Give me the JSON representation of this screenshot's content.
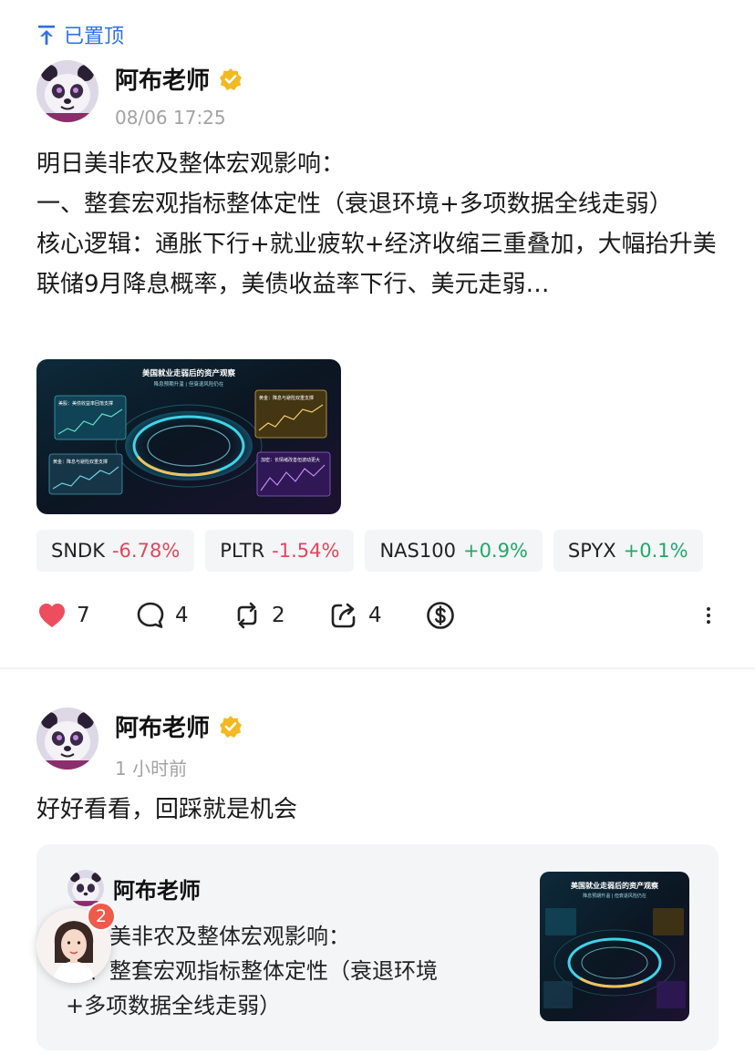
{
  "pinned": {
    "label": "已置顶",
    "icon": "pin-top-icon",
    "color": "#2f6fe8"
  },
  "post1": {
    "author": "阿布老师",
    "verified_icon": "verified-badge-icon",
    "time": "08/06 17:25",
    "lines": [
      "明日美非农及整体宏观影响：",
      "一、整套宏观指标整体定性（衰退环境+多项数据全线走弱）",
      "核心逻辑：通胀下行+就业疲软+经济收缩三重叠加，大幅抬升美联储9月降息概率，美债收益率下行、美元走弱…"
    ],
    "image": {
      "title": "美国就业走弱后的资产观察",
      "subtitle": "降息预期升温 | 但衰退风险仍在",
      "panel1": "美股：美债收益率回落支撑",
      "panel2": "黄金：降息与避险双重支撑",
      "panel3": "黄金：降息与避险双重支撑",
      "panel4": "加密：长情绪改善但波动更大"
    },
    "tickers": [
      {
        "symbol": "SNDK",
        "change": "-6.78%",
        "dir": "down"
      },
      {
        "symbol": "PLTR",
        "change": "-1.54%",
        "dir": "down"
      },
      {
        "symbol": "NAS100",
        "change": "+0.9%",
        "dir": "up"
      },
      {
        "symbol": "SPYX",
        "change": "+0.1%",
        "dir": "up"
      }
    ],
    "actions": {
      "likes": "7",
      "comments": "4",
      "reposts": "2",
      "shares": "4"
    },
    "colors": {
      "down": "#e0475e",
      "up": "#21a86b",
      "like": "#ee4d5f"
    }
  },
  "post2": {
    "author": "阿布老师",
    "time": "1 小时前",
    "text": "好好看看，回踩就是机会",
    "quote": {
      "author": "阿布老师",
      "lines": [
        "明日美非农及整体宏观影响：",
        "一、整套宏观指标整体定性（衰退环境",
        "+多项数据全线走弱）"
      ],
      "image_title": "美国就业走弱后的资产观察",
      "image_subtitle": "降息预期升温 | 但衰退风险仍在"
    }
  },
  "floating": {
    "badge_count": "2"
  }
}
